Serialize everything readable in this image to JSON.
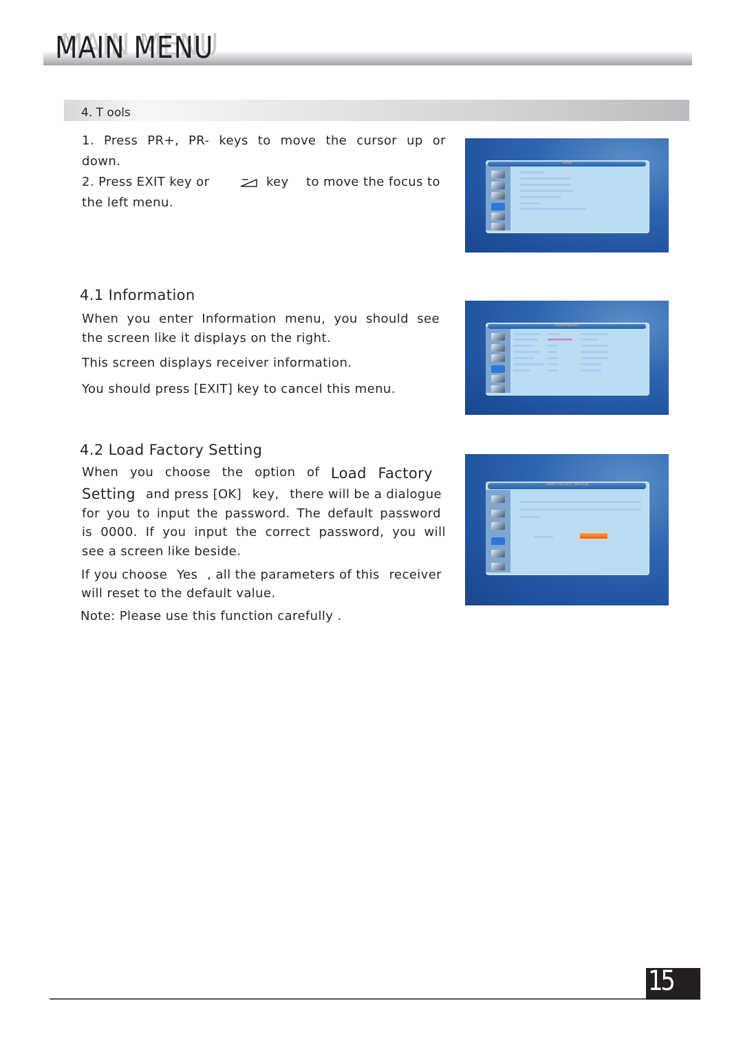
{
  "header": {
    "title": "MAIN  MENU",
    "title_shadow": "MAIN  MENU"
  },
  "section": {
    "label": "4. T ools"
  },
  "tools": {
    "step1": {
      "parts": [
        "1.",
        "Press",
        "PR+,",
        "PR-",
        "keys",
        "to",
        "move",
        "the",
        "cursor",
        "up",
        "or"
      ],
      "line2": "down."
    },
    "step2": {
      "prefix": "2. Press   EXIT   key or",
      "key_icon": "back-key-icon",
      "suffix_key": "key",
      "suffix": "to move the focus to",
      "line2": "the left menu."
    }
  },
  "information": {
    "heading": "4.1  Information",
    "p1_line1": [
      "When",
      "you",
      "enter",
      "Information",
      "menu,",
      "you",
      "should",
      "see"
    ],
    "p1_line2": "the screen like  it displays on  the right.",
    "p2": "This screen displays    receiver information.",
    "p3": "You should press [EXIT]    key to cancel  this menu."
  },
  "factory": {
    "heading": "4.2  Load Factory     Setting",
    "p1_line1": [
      "When",
      "you",
      "choose",
      "the",
      "option",
      "of",
      "Load",
      "Factory"
    ],
    "p1_line2_big": "Setting",
    "p1_line2_rest": [
      "and press [OK]",
      "key,",
      "there will be a dialogue"
    ],
    "p1_line3": [
      "for",
      "you",
      "to",
      "input",
      "the",
      "password.",
      "The",
      "default",
      "password"
    ],
    "p1_line4": [
      "is",
      "0000.",
      "If",
      "you",
      "input",
      "the",
      "correct",
      "password,",
      "you",
      "will"
    ],
    "p1_line5": "see a screen   like beside.",
    "p2_line1": [
      "If you choose",
      "Yes",
      ", all the parameters of this",
      "receiver"
    ],
    "p2_line2": "will reset to the default value.",
    "note": "Note:  Please use this    function carefully ."
  },
  "screenshots": {
    "tools_menu": {
      "title": "Tools",
      "items": 6
    },
    "information_menu": {
      "title": "Information",
      "rows": 7
    },
    "factory_dialog": {
      "title": "Load Factory Setting",
      "selected_button_color": "#f07a24"
    }
  },
  "footer": {
    "page_number": "15"
  }
}
